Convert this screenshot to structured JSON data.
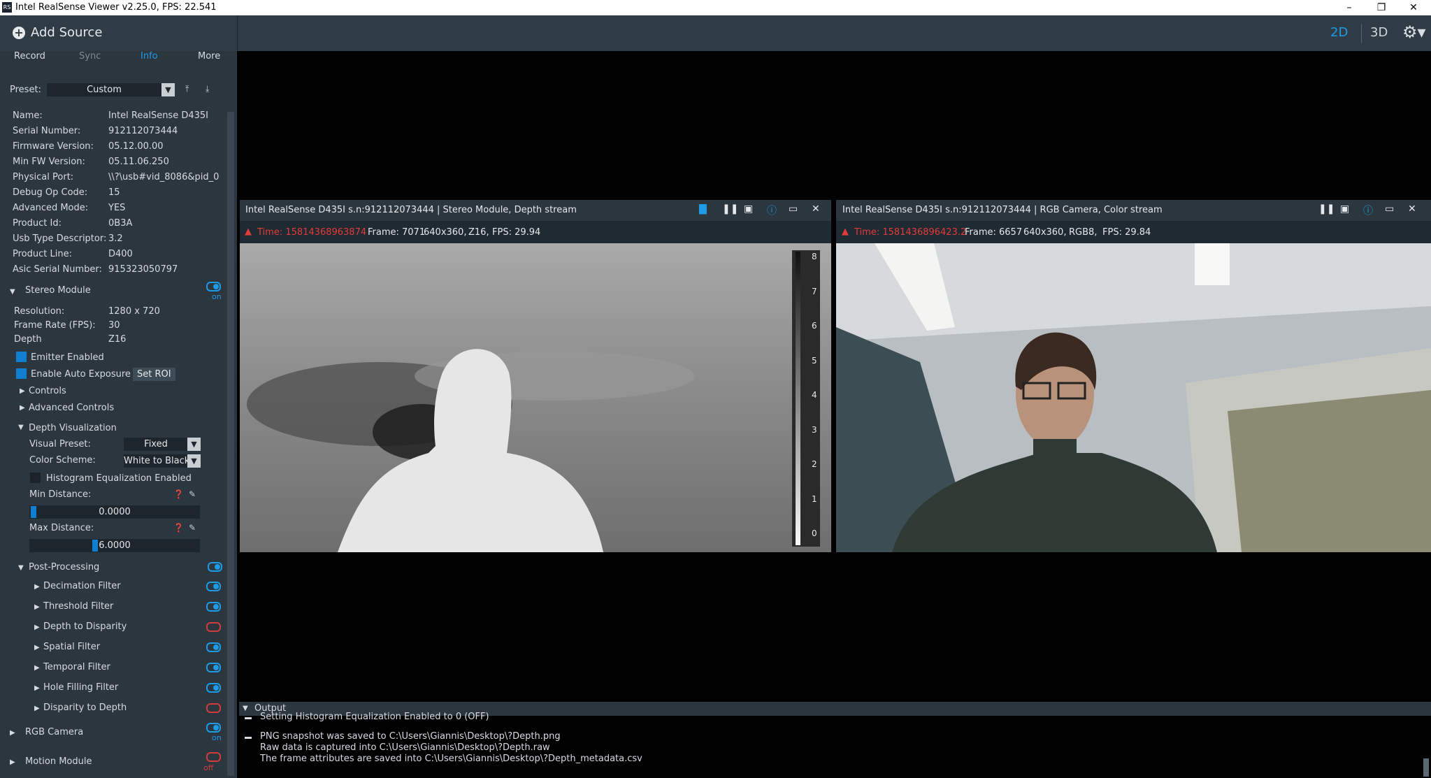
{
  "window": {
    "title": "Intel RealSense Viewer v2.25.0, FPS: 22.541",
    "app_icon": "RS"
  },
  "toolbar": {
    "add_source": "Add Source",
    "mode_2d": "2D",
    "mode_3d": "3D"
  },
  "tabs": [
    "Record",
    "Sync",
    "Info",
    "More"
  ],
  "preset": {
    "label": "Preset:",
    "value": "Custom"
  },
  "info": [
    {
      "k": "Name:",
      "v": "Intel RealSense D435I"
    },
    {
      "k": "Serial Number:",
      "v": "912112073444"
    },
    {
      "k": "Firmware Version:",
      "v": "05.12.00.00"
    },
    {
      "k": "Min FW Version:",
      "v": "05.11.06.250"
    },
    {
      "k": "Physical Port:",
      "v": "\\\\?\\usb#vid_8086&pid_0"
    },
    {
      "k": "Debug Op Code:",
      "v": "15"
    },
    {
      "k": "Advanced Mode:",
      "v": "YES"
    },
    {
      "k": "Product Id:",
      "v": "0B3A"
    },
    {
      "k": "Usb Type Descriptor:",
      "v": "3.2"
    },
    {
      "k": "Product Line:",
      "v": "D400"
    },
    {
      "k": "Asic Serial Number:",
      "v": "915323050797"
    }
  ],
  "stereo": {
    "title": "Stereo Module",
    "state": "on",
    "resolution_label": "Resolution:",
    "resolution": "1280 x 720",
    "fps_label": "Frame Rate (FPS):",
    "fps": "30",
    "depth_label": "Depth",
    "depth": "Z16",
    "emitter": "Emitter Enabled",
    "auto_exposure": "Enable Auto Exposure",
    "set_roi": "Set ROI",
    "controls": "Controls",
    "advanced_controls": "Advanced Controls",
    "depth_vis": "Depth Visualization",
    "visual_preset_label": "Visual Preset:",
    "visual_preset": "Fixed",
    "color_scheme_label": "Color Scheme:",
    "color_scheme": "White to Black",
    "histogram": "Histogram Equalization Enabled",
    "min_distance_label": "Min Distance:",
    "min_distance": "0.0000",
    "max_distance_label": "Max Distance:",
    "max_distance": "6.0000",
    "min_distance_fraction": 0.0,
    "max_distance_fraction": 0.375,
    "post_processing": "Post-Processing",
    "filters": [
      {
        "name": "Decimation Filter",
        "enabled": true
      },
      {
        "name": "Threshold Filter",
        "enabled": true
      },
      {
        "name": "Depth to Disparity",
        "enabled": false
      },
      {
        "name": "Spatial Filter",
        "enabled": true
      },
      {
        "name": "Temporal Filter",
        "enabled": true
      },
      {
        "name": "Hole Filling Filter",
        "enabled": true
      },
      {
        "name": "Disparity to Depth",
        "enabled": false
      }
    ]
  },
  "rgb_camera": {
    "title": "RGB Camera",
    "state": "on"
  },
  "motion_module": {
    "title": "Motion Module",
    "state": "off"
  },
  "depth_view": {
    "title": "Intel RealSense D435I s.n:912112073444 | Stereo Module, Depth stream",
    "time": "Time: 15814368963874",
    "frame": "Frame: 7071",
    "res": "640x360,",
    "format": "Z16,",
    "fps": "FPS:   29.94",
    "scale": [
      "8",
      "7",
      "6",
      "5",
      "4",
      "3",
      "2",
      "1",
      "0"
    ]
  },
  "color_view": {
    "title": "Intel RealSense D435I s.n:912112073444 | RGB Camera, Color stream",
    "time": "Time: 1581436896423.2",
    "frame": "Frame: 6657",
    "res": "640x360,",
    "format": "RGB8,",
    "fps": "FPS:   29.84"
  },
  "output": {
    "title": "Output",
    "lines": [
      "Setting Histogram Equalization Enabled to 0 (OFF)",
      "PNG snapshot was saved to C:\\Users\\Giannis\\Desktop\\?Depth.png",
      "Raw data is captured into C:\\Users\\Giannis\\Desktop\\?Depth.raw",
      "The frame attributes are saved into C:\\Users\\Giannis\\Desktop\\?Depth_metadata.csv"
    ]
  },
  "colors": {
    "accent": "#1e9be6",
    "warn": "#e23b3b",
    "panel": "#2b363f"
  }
}
